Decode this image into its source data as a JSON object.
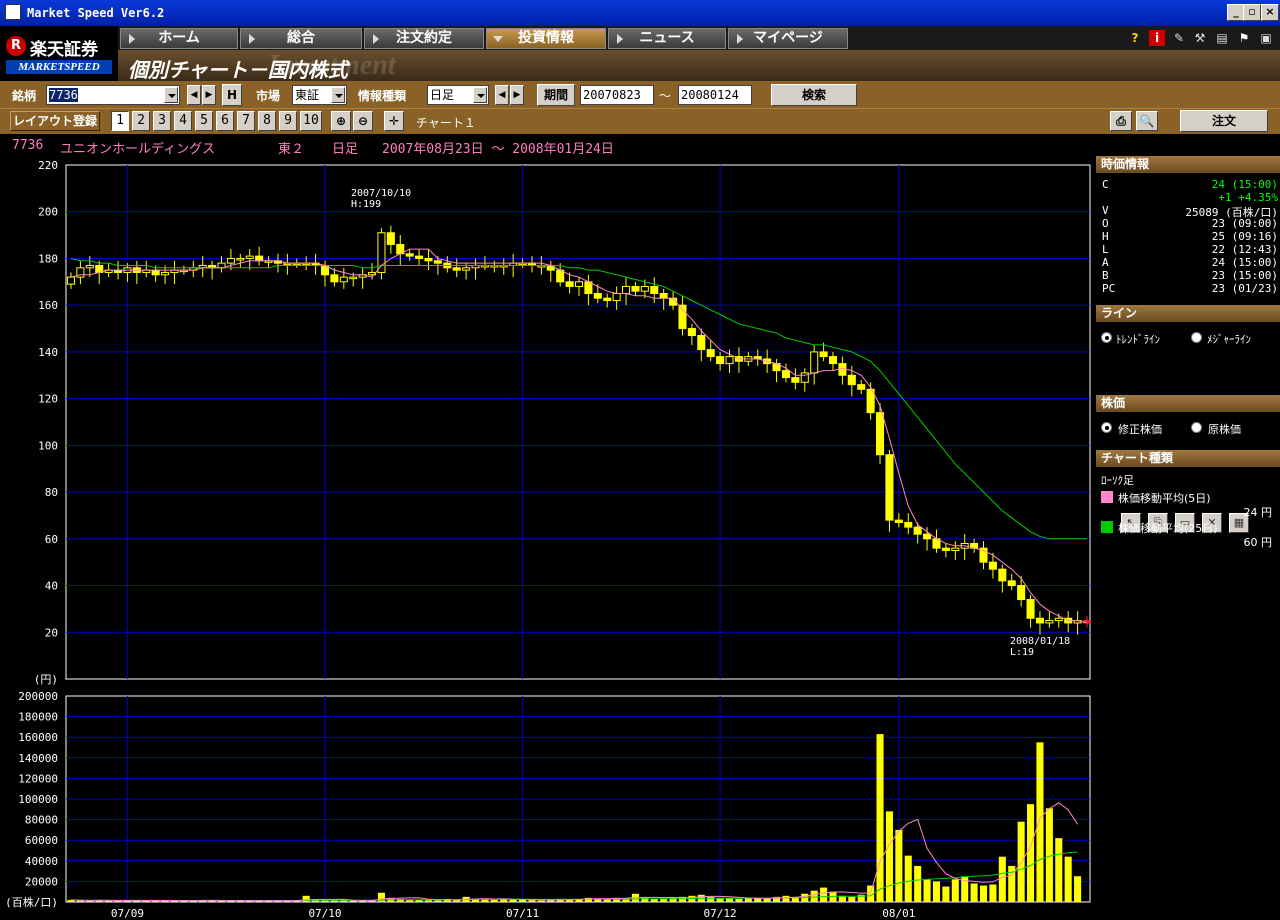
{
  "window": {
    "title": "Market Speed Ver6.2"
  },
  "brand": {
    "name": "楽天証券",
    "sub": "MARKETSPEED",
    "r": "R"
  },
  "nav": {
    "tabs": [
      "ホーム",
      "総合",
      "注文約定",
      "投資情報",
      "ニュース",
      "マイページ"
    ],
    "active": 3
  },
  "page": {
    "title": "個別チャート－国内株式",
    "watermark": "Investment"
  },
  "controls": {
    "symbol_label": "銘柄",
    "symbol_value": "7736",
    "h_label": "H",
    "market_label": "市場",
    "market_value": "東証",
    "info_label": "情報種類",
    "info_value": "日足",
    "period_label": "期間",
    "period_from": "20070823",
    "period_sep": "～",
    "period_to": "20080124",
    "search_label": "検索",
    "layout_label": "レイアウト登録",
    "layout_numbers": [
      "1",
      "2",
      "3",
      "4",
      "5",
      "6",
      "7",
      "8",
      "9",
      "10"
    ],
    "chart_name": "チャート１",
    "order_label": "注文"
  },
  "info_line": {
    "code": "7736",
    "name": "ユニオンホールディングス",
    "market": "東２",
    "type": "日足",
    "range": "2007年08月23日 ～ 2008年01月24日"
  },
  "side": {
    "price_header": "時価情報",
    "price_rows": [
      {
        "k": "C",
        "v": "24",
        "t": "(15:00)",
        "color": "#00ff00"
      },
      {
        "k": "",
        "v": "+1",
        "t": "+4.35%",
        "color": "#00ff00"
      },
      {
        "k": "V",
        "v": "25089",
        "t": "(百株/口)",
        "color": "#ffffff"
      },
      {
        "k": "O",
        "v": "23",
        "t": "(09:00)",
        "color": "#ffffff"
      },
      {
        "k": "H",
        "v": "25",
        "t": "(09:16)",
        "color": "#ffffff"
      },
      {
        "k": "L",
        "v": "22",
        "t": "(12:43)",
        "color": "#ffffff"
      },
      {
        "k": "A",
        "v": "24",
        "t": "(15:00)",
        "color": "#ffffff"
      },
      {
        "k": "B",
        "v": "23",
        "t": "(15:00)",
        "color": "#ffffff"
      },
      {
        "k": "PC",
        "v": "23",
        "t": "(01/23)",
        "color": "#ffffff"
      }
    ],
    "line_header": "ライン",
    "line_opts": [
      "ﾄﾚﾝﾄﾞﾗｲﾝ",
      "ﾒｼﾞｬｰﾗｲﾝ"
    ],
    "stock_header": "株価",
    "stock_opts": [
      "修正株価",
      "原株価"
    ],
    "chart_header": "チャート種類",
    "chart_type": "ﾛｰｿｸ足",
    "ma5_label": "株価移動平均(5日)",
    "ma5_value": "24 円",
    "ma25_label": "株価移動平均(25日)",
    "ma25_value": "60 円",
    "ma5_color": "#ff88cc",
    "ma25_color": "#00cc00"
  },
  "chart_data": {
    "type": "candlestick",
    "price_axis": {
      "ylim": [
        0,
        220
      ],
      "ticks": [
        20,
        40,
        60,
        80,
        100,
        120,
        140,
        160,
        180,
        200,
        220
      ],
      "unit": "(円)"
    },
    "volume_axis": {
      "ylim": [
        0,
        200000
      ],
      "ticks": [
        20000,
        40000,
        60000,
        80000,
        100000,
        120000,
        140000,
        160000,
        180000,
        200000
      ],
      "unit": "(百株/口)"
    },
    "x_labels": [
      "07/09",
      "07/10",
      "07/11",
      "07/12",
      "08/01"
    ],
    "annotations": [
      {
        "text": "2007/10/10",
        "sub": "H:199"
      },
      {
        "text": "2008/01/18",
        "sub": "L:19"
      }
    ],
    "candle_color": "#ffff00",
    "grid_color": "#0000cc",
    "close": [
      172,
      176,
      177,
      174,
      175,
      174,
      176,
      174,
      175,
      173,
      174,
      175,
      175,
      176,
      177,
      176,
      178,
      180,
      180,
      181,
      179,
      179,
      178,
      178,
      178,
      178,
      177,
      173,
      170,
      172,
      172,
      173,
      174,
      191,
      186,
      182,
      181,
      180,
      179,
      178,
      176,
      175,
      176,
      177,
      177,
      177,
      177,
      178,
      178,
      177,
      177,
      175,
      170,
      168,
      170,
      165,
      163,
      162,
      165,
      168,
      166,
      168,
      165,
      163,
      160,
      150,
      147,
      141,
      138,
      135,
      138,
      136,
      138,
      137,
      135,
      132,
      129,
      127,
      131,
      140,
      138,
      135,
      130,
      126,
      124,
      114,
      96,
      68,
      67,
      65,
      62,
      60,
      56,
      55,
      56,
      58,
      56,
      50,
      47,
      42,
      40,
      34,
      26,
      24,
      25,
      26,
      24,
      25,
      24
    ],
    "ma5": [
      172,
      173,
      173,
      174,
      175,
      175,
      175,
      175,
      175,
      175,
      175,
      175,
      175,
      175,
      176,
      176,
      176,
      177,
      178,
      179,
      179,
      179,
      179,
      178,
      178,
      178,
      178,
      177,
      175,
      174,
      173,
      173,
      172,
      177,
      180,
      182,
      184,
      184,
      184,
      180,
      179,
      178,
      178,
      178,
      178,
      178,
      178,
      178,
      178,
      178,
      178,
      177,
      175,
      173,
      172,
      170,
      168,
      166,
      165,
      165,
      164,
      164,
      163,
      163,
      163,
      158,
      154,
      149,
      145,
      141,
      139,
      137,
      137,
      137,
      136,
      135,
      133,
      130,
      130,
      131,
      132,
      132,
      133,
      132,
      130,
      125,
      117,
      103,
      88,
      74,
      66,
      63,
      60,
      58,
      57,
      57,
      56,
      55,
      53,
      50,
      47,
      43,
      37,
      32,
      29,
      27,
      25,
      25,
      24
    ],
    "ma25": [
      180,
      179,
      179,
      178,
      178,
      177,
      177,
      177,
      177,
      176,
      176,
      176,
      176,
      176,
      176,
      176,
      176,
      176,
      176,
      176,
      176,
      176,
      177,
      177,
      177,
      177,
      177,
      177,
      177,
      177,
      177,
      176,
      176,
      177,
      177,
      177,
      177,
      177,
      177,
      177,
      177,
      177,
      177,
      177,
      177,
      177,
      177,
      177,
      177,
      177,
      177,
      177,
      177,
      176,
      176,
      175,
      175,
      174,
      173,
      172,
      171,
      170,
      169,
      168,
      166,
      164,
      162,
      160,
      158,
      156,
      154,
      152,
      151,
      150,
      149,
      148,
      146,
      145,
      144,
      143,
      143,
      142,
      141,
      140,
      138,
      136,
      132,
      127,
      122,
      117,
      112,
      107,
      102,
      97,
      92,
      88,
      84,
      80,
      76,
      72,
      69,
      66,
      63,
      61,
      60,
      60,
      60,
      60,
      60
    ],
    "volume": [
      2000,
      1500,
      1200,
      1800,
      1400,
      1600,
      1300,
      1500,
      1700,
      1200,
      1400,
      1300,
      1600,
      1500,
      1800,
      1400,
      1300,
      1500,
      1200,
      1600,
      1400,
      1300,
      1500,
      1200,
      1400,
      6000,
      2000,
      1800,
      1500,
      1600,
      1400,
      1300,
      1500,
      9000,
      4000,
      3000,
      2500,
      2000,
      1800,
      1500,
      3000,
      2000,
      5000,
      3000,
      2500,
      2000,
      3000,
      2500,
      2000,
      1800,
      1500,
      2000,
      3000,
      2500,
      3000,
      4000,
      3500,
      3000,
      4000,
      3500,
      8000,
      4000,
      3000,
      3500,
      4000,
      5000,
      6000,
      7000,
      5000,
      4000,
      3500,
      3000,
      4000,
      3500,
      3000,
      5000,
      6000,
      5000,
      8000,
      11000,
      14000,
      10000,
      6000,
      5000,
      7000,
      16000,
      163000,
      88000,
      70000,
      45000,
      35000,
      22000,
      20000,
      15000,
      22000,
      25000,
      18000,
      16000,
      17000,
      44000,
      35000,
      78000,
      95000,
      155000,
      91000,
      62000,
      44000,
      25000
    ]
  }
}
